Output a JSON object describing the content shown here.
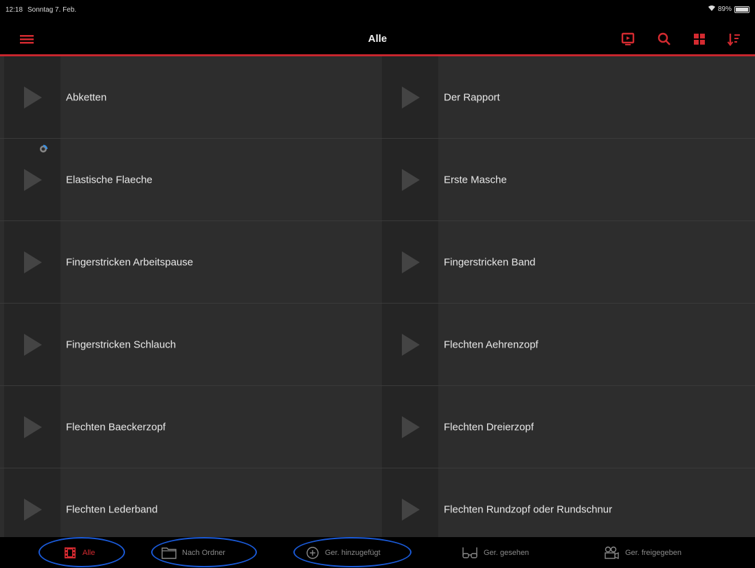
{
  "status": {
    "time": "12:18",
    "date": "Sonntag 7. Feb.",
    "battery": "89%"
  },
  "nav": {
    "title": "Alle"
  },
  "accent": "#c8262d",
  "items": [
    "Abketten",
    "Der Rapport",
    "Elastische Flaeche",
    "Erste Masche",
    "Fingerstricken Arbeitspause",
    "Fingerstricken Band",
    "Fingerstricken Schlauch",
    "Flechten Aehrenzopf",
    "Flechten Baeckerzopf",
    "Flechten Dreierzopf",
    "Flechten Lederband",
    "Flechten Rundzopf oder Rundschnur"
  ],
  "tabs": [
    {
      "label": "Alle",
      "icon": "film-icon"
    },
    {
      "label": "Nach Ordner",
      "icon": "folder-icon"
    },
    {
      "label": "Ger. hinzugefügt",
      "icon": "plus-circle-icon"
    },
    {
      "label": "Ger. gesehen",
      "icon": "glasses-icon"
    },
    {
      "label": "Ger. freigegeben",
      "icon": "camera-icon"
    }
  ]
}
